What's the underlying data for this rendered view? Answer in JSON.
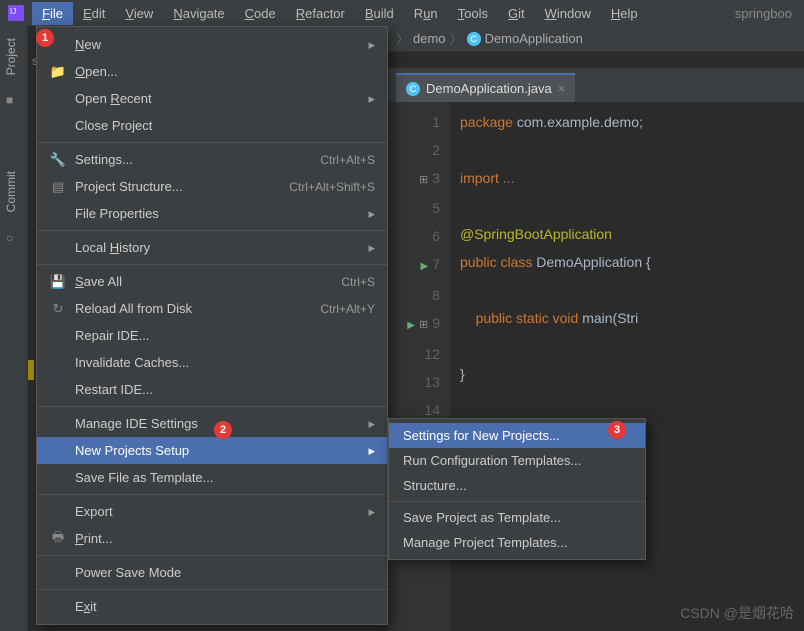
{
  "menubar": {
    "items": [
      "File",
      "Edit",
      "View",
      "Navigate",
      "Code",
      "Refactor",
      "Build",
      "Run",
      "Tools",
      "Git",
      "Window",
      "Help"
    ],
    "project": "springboo"
  },
  "left_tabs": {
    "project": "Project",
    "commit": "Commit",
    "sp": "spi"
  },
  "file_menu": {
    "new": "New",
    "open": "Open...",
    "open_recent": "Open Recent",
    "close_project": "Close Project",
    "settings": "Settings...",
    "settings_sc": "Ctrl+Alt+S",
    "proj_struct": "Project Structure...",
    "proj_struct_sc": "Ctrl+Alt+Shift+S",
    "file_props": "File Properties",
    "local_hist": "Local History",
    "save_all": "Save All",
    "save_all_sc": "Ctrl+S",
    "reload": "Reload All from Disk",
    "reload_sc": "Ctrl+Alt+Y",
    "repair": "Repair IDE...",
    "invalidate": "Invalidate Caches...",
    "restart": "Restart IDE...",
    "manage_ide": "Manage IDE Settings",
    "new_projects": "New Projects Setup",
    "save_tmpl": "Save File as Template...",
    "export": "Export",
    "print": "Print...",
    "power_save": "Power Save Mode",
    "exit": "Exit"
  },
  "submenu": {
    "settings_new": "Settings for New Projects...",
    "run_cfg": "Run Configuration Templates...",
    "structure": "Structure...",
    "save_proj_tmpl": "Save Project as Template...",
    "manage_proj_tmpl": "Manage Project Templates..."
  },
  "breadcrumb": {
    "demo": "demo",
    "app": "DemoApplication"
  },
  "editor_tab": {
    "name": "DemoApplication.java"
  },
  "gutter_lines": [
    "1",
    "2",
    "3",
    "5",
    "6",
    "7",
    "8",
    "9",
    "12",
    "13",
    "14"
  ],
  "code": {
    "l1_kw": "package",
    "l1_rest": " com.example.demo;",
    "l3_kw": "import",
    "l3_rest": " ...",
    "l6": "@SpringBootApplication",
    "l7_kw1": "public",
    "l7_kw2": "class",
    "l7_name": " DemoApplication {",
    "l9_kw1": "public",
    "l9_kw2": "static",
    "l9_kw3": "void",
    "l9_name": " main(Stri",
    "l13": "}"
  },
  "watermark": "CSDN @是烟花哈",
  "badges": {
    "b1": "1",
    "b2": "2",
    "b3": "3"
  }
}
